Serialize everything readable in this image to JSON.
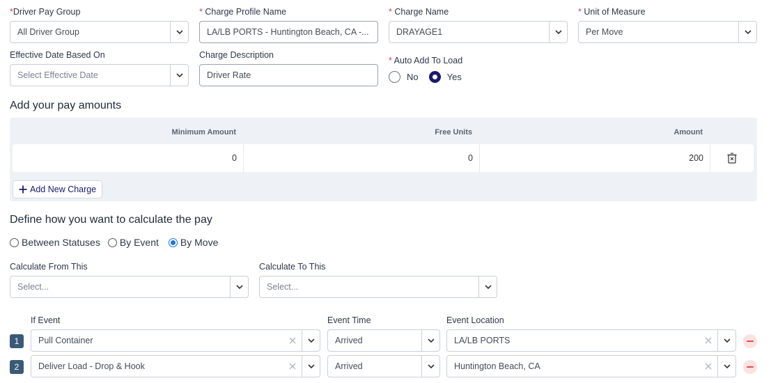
{
  "form": {
    "driver_pay_group": {
      "label": "Driver Pay Group",
      "required_mark": "*",
      "value": "All Driver Group"
    },
    "charge_profile_name": {
      "label": "Charge Profile Name",
      "required_mark": "*",
      "value": "LA/LB PORTS - Huntington Beach, CA -..."
    },
    "charge_name": {
      "label": "Charge Name",
      "required_mark": "*",
      "value": "DRAYAGE1"
    },
    "unit_of_measure": {
      "label": "Unit of Measure",
      "required_mark": "*",
      "value": "Per Move"
    },
    "effective_date": {
      "label": "Effective Date Based On",
      "placeholder": "Select Effective Date"
    },
    "charge_description": {
      "label": "Charge Description",
      "value": "Driver Rate"
    },
    "auto_add": {
      "label": "Auto Add To Load",
      "required_mark": "*",
      "options": [
        "No",
        "Yes"
      ],
      "selected": "Yes"
    }
  },
  "pay_amounts": {
    "title": "Add your pay amounts",
    "headers": [
      "Minimum Amount",
      "Free Units",
      "Amount"
    ],
    "rows": [
      {
        "minimum": "0",
        "free_units": "0",
        "amount": "200"
      }
    ],
    "add_button": "Add New Charge"
  },
  "calculation": {
    "title": "Define how you want to calculate the pay",
    "methods": [
      "Between Statuses",
      "By Event",
      "By Move"
    ],
    "selected": "By Move",
    "from": {
      "label": "Calculate From This",
      "placeholder": "Select..."
    },
    "to": {
      "label": "Calculate To This",
      "placeholder": "Select..."
    }
  },
  "events": {
    "headers": {
      "event": "If Event",
      "time": "Event Time",
      "location": "Event Location"
    },
    "rows": [
      {
        "index": "1",
        "event": "Pull Container",
        "time": "Arrived",
        "location": "LA/LB PORTS"
      },
      {
        "index": "2",
        "event": "Deliver Load - Drop & Hook",
        "time": "Arrived",
        "location": "Huntington Beach, CA"
      }
    ]
  },
  "icons": {
    "dropdown": "chevron-down-icon",
    "clear": "close-icon",
    "delete_row": "trash-icon",
    "add": "plus-icon",
    "remove": "minus-circle-icon"
  },
  "colors": {
    "required": "#e53e3e",
    "accent": "#1a1a6e",
    "radio_selected": "#1a73e8",
    "panel": "#eef1f6",
    "index_badge": "#3b5a78",
    "remove": "#e24b4b"
  }
}
